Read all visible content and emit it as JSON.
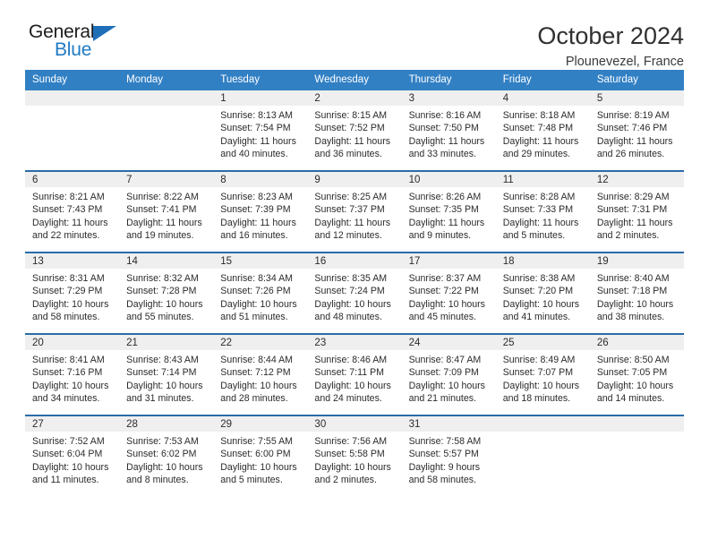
{
  "brand": {
    "word_general": "General",
    "word_blue": "Blue",
    "flag_icon": "triangle-flag-icon"
  },
  "header": {
    "title": "October 2024",
    "location": "Plounevezel, France"
  },
  "calendar": {
    "weekday_headers": [
      "Sunday",
      "Monday",
      "Tuesday",
      "Wednesday",
      "Thursday",
      "Friday",
      "Saturday"
    ],
    "colors": {
      "header_bg": "#3280c4",
      "row_divider": "#2a6ca8",
      "daynum_band": "#efefef",
      "text": "#2b2b2b",
      "brand_blue": "#1f7ac4"
    },
    "weeks": [
      [
        {
          "day": "",
          "lines": []
        },
        {
          "day": "",
          "lines": []
        },
        {
          "day": "1",
          "lines": [
            "Sunrise: 8:13 AM",
            "Sunset: 7:54 PM",
            "Daylight: 11 hours",
            "and 40 minutes."
          ]
        },
        {
          "day": "2",
          "lines": [
            "Sunrise: 8:15 AM",
            "Sunset: 7:52 PM",
            "Daylight: 11 hours",
            "and 36 minutes."
          ]
        },
        {
          "day": "3",
          "lines": [
            "Sunrise: 8:16 AM",
            "Sunset: 7:50 PM",
            "Daylight: 11 hours",
            "and 33 minutes."
          ]
        },
        {
          "day": "4",
          "lines": [
            "Sunrise: 8:18 AM",
            "Sunset: 7:48 PM",
            "Daylight: 11 hours",
            "and 29 minutes."
          ]
        },
        {
          "day": "5",
          "lines": [
            "Sunrise: 8:19 AM",
            "Sunset: 7:46 PM",
            "Daylight: 11 hours",
            "and 26 minutes."
          ]
        }
      ],
      [
        {
          "day": "6",
          "lines": [
            "Sunrise: 8:21 AM",
            "Sunset: 7:43 PM",
            "Daylight: 11 hours",
            "and 22 minutes."
          ]
        },
        {
          "day": "7",
          "lines": [
            "Sunrise: 8:22 AM",
            "Sunset: 7:41 PM",
            "Daylight: 11 hours",
            "and 19 minutes."
          ]
        },
        {
          "day": "8",
          "lines": [
            "Sunrise: 8:23 AM",
            "Sunset: 7:39 PM",
            "Daylight: 11 hours",
            "and 16 minutes."
          ]
        },
        {
          "day": "9",
          "lines": [
            "Sunrise: 8:25 AM",
            "Sunset: 7:37 PM",
            "Daylight: 11 hours",
            "and 12 minutes."
          ]
        },
        {
          "day": "10",
          "lines": [
            "Sunrise: 8:26 AM",
            "Sunset: 7:35 PM",
            "Daylight: 11 hours",
            "and 9 minutes."
          ]
        },
        {
          "day": "11",
          "lines": [
            "Sunrise: 8:28 AM",
            "Sunset: 7:33 PM",
            "Daylight: 11 hours",
            "and 5 minutes."
          ]
        },
        {
          "day": "12",
          "lines": [
            "Sunrise: 8:29 AM",
            "Sunset: 7:31 PM",
            "Daylight: 11 hours",
            "and 2 minutes."
          ]
        }
      ],
      [
        {
          "day": "13",
          "lines": [
            "Sunrise: 8:31 AM",
            "Sunset: 7:29 PM",
            "Daylight: 10 hours",
            "and 58 minutes."
          ]
        },
        {
          "day": "14",
          "lines": [
            "Sunrise: 8:32 AM",
            "Sunset: 7:28 PM",
            "Daylight: 10 hours",
            "and 55 minutes."
          ]
        },
        {
          "day": "15",
          "lines": [
            "Sunrise: 8:34 AM",
            "Sunset: 7:26 PM",
            "Daylight: 10 hours",
            "and 51 minutes."
          ]
        },
        {
          "day": "16",
          "lines": [
            "Sunrise: 8:35 AM",
            "Sunset: 7:24 PM",
            "Daylight: 10 hours",
            "and 48 minutes."
          ]
        },
        {
          "day": "17",
          "lines": [
            "Sunrise: 8:37 AM",
            "Sunset: 7:22 PM",
            "Daylight: 10 hours",
            "and 45 minutes."
          ]
        },
        {
          "day": "18",
          "lines": [
            "Sunrise: 8:38 AM",
            "Sunset: 7:20 PM",
            "Daylight: 10 hours",
            "and 41 minutes."
          ]
        },
        {
          "day": "19",
          "lines": [
            "Sunrise: 8:40 AM",
            "Sunset: 7:18 PM",
            "Daylight: 10 hours",
            "and 38 minutes."
          ]
        }
      ],
      [
        {
          "day": "20",
          "lines": [
            "Sunrise: 8:41 AM",
            "Sunset: 7:16 PM",
            "Daylight: 10 hours",
            "and 34 minutes."
          ]
        },
        {
          "day": "21",
          "lines": [
            "Sunrise: 8:43 AM",
            "Sunset: 7:14 PM",
            "Daylight: 10 hours",
            "and 31 minutes."
          ]
        },
        {
          "day": "22",
          "lines": [
            "Sunrise: 8:44 AM",
            "Sunset: 7:12 PM",
            "Daylight: 10 hours",
            "and 28 minutes."
          ]
        },
        {
          "day": "23",
          "lines": [
            "Sunrise: 8:46 AM",
            "Sunset: 7:11 PM",
            "Daylight: 10 hours",
            "and 24 minutes."
          ]
        },
        {
          "day": "24",
          "lines": [
            "Sunrise: 8:47 AM",
            "Sunset: 7:09 PM",
            "Daylight: 10 hours",
            "and 21 minutes."
          ]
        },
        {
          "day": "25",
          "lines": [
            "Sunrise: 8:49 AM",
            "Sunset: 7:07 PM",
            "Daylight: 10 hours",
            "and 18 minutes."
          ]
        },
        {
          "day": "26",
          "lines": [
            "Sunrise: 8:50 AM",
            "Sunset: 7:05 PM",
            "Daylight: 10 hours",
            "and 14 minutes."
          ]
        }
      ],
      [
        {
          "day": "27",
          "lines": [
            "Sunrise: 7:52 AM",
            "Sunset: 6:04 PM",
            "Daylight: 10 hours",
            "and 11 minutes."
          ]
        },
        {
          "day": "28",
          "lines": [
            "Sunrise: 7:53 AM",
            "Sunset: 6:02 PM",
            "Daylight: 10 hours",
            "and 8 minutes."
          ]
        },
        {
          "day": "29",
          "lines": [
            "Sunrise: 7:55 AM",
            "Sunset: 6:00 PM",
            "Daylight: 10 hours",
            "and 5 minutes."
          ]
        },
        {
          "day": "30",
          "lines": [
            "Sunrise: 7:56 AM",
            "Sunset: 5:58 PM",
            "Daylight: 10 hours",
            "and 2 minutes."
          ]
        },
        {
          "day": "31",
          "lines": [
            "Sunrise: 7:58 AM",
            "Sunset: 5:57 PM",
            "Daylight: 9 hours",
            "and 58 minutes."
          ]
        },
        {
          "day": "",
          "lines": []
        },
        {
          "day": "",
          "lines": []
        }
      ]
    ]
  }
}
